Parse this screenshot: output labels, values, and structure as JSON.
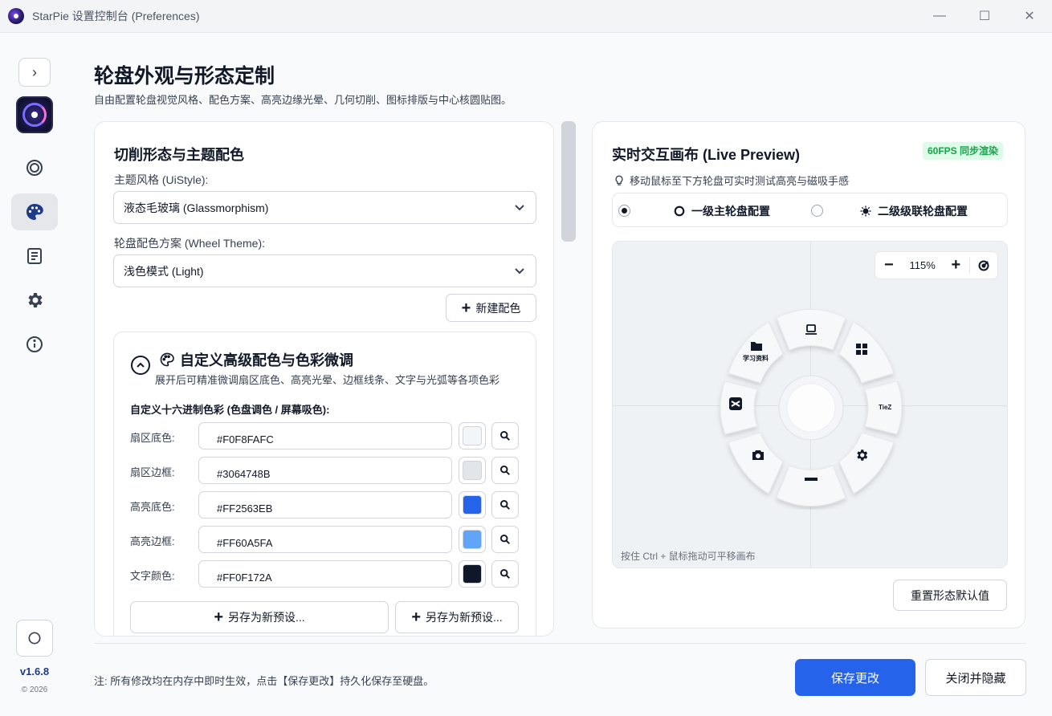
{
  "window": {
    "title": "StarPie 设置控制台 (Preferences)",
    "minimize_icon": "—",
    "maximize_icon": "☐",
    "close_icon": "✕"
  },
  "sidebar": {
    "toggle_glyph": "›",
    "version": "v1.6.8",
    "copyright": "© 2026",
    "items": [
      {
        "icon": "target-icon",
        "active": false
      },
      {
        "icon": "palette-icon",
        "active": true
      },
      {
        "icon": "document-icon",
        "active": false
      },
      {
        "icon": "gear-icon",
        "active": false
      },
      {
        "icon": "info-icon",
        "active": false
      }
    ]
  },
  "header": {
    "title": "轮盘外观与形态定制",
    "subtitle": "自由配置轮盘视觉风格、配色方案、高亮边缘光晕、几何切削、图标排版与中心核圆贴图。"
  },
  "left": {
    "section_title": "切削形态与主题配色",
    "style_label": "主题风格 (UiStyle):",
    "style_value": "液态毛玻璃 (Glassmorphism)",
    "theme_label": "轮盘配色方案 (Wheel Theme):",
    "theme_value": "浅色模式 (Light)",
    "new_theme_label": "新建配色",
    "advanced": {
      "title": "自定义高级配色与色彩微调",
      "desc": "展开后可精准微调扇区底色、高亮光晕、边框线条、文字与光弧等各项色彩",
      "hex_title": "自定义十六进制色彩 (色盘调色 / 屏幕吸色):",
      "colors": [
        {
          "label": "扇区底色:",
          "hex": "#F0F8FAFC",
          "swatch": "#f3f6f9"
        },
        {
          "label": "扇区边框:",
          "hex": "#3064748B",
          "swatch": "#e2e5ea"
        },
        {
          "label": "高亮底色:",
          "hex": "#FF2563EB",
          "swatch": "#2563eb"
        },
        {
          "label": "高亮边框:",
          "hex": "#FF60A5FA",
          "swatch": "#60a5fa"
        },
        {
          "label": "文字颜色:",
          "hex": "#FF0F172A",
          "swatch": "#0f172a"
        }
      ],
      "save_preset_1": "另存为新预设...",
      "save_preset_2": "另存为新预设..."
    }
  },
  "right": {
    "title": "实时交互画布 (Live Preview)",
    "fps_badge": "60FPS 同步渲染",
    "hint": "移动鼠标至下方轮盘可实时测试高亮与磁吸手感",
    "radio_primary": "一级主轮盘配置",
    "radio_secondary": "二级级联轮盘配置",
    "zoom": "115%",
    "canvas_hint": "按住 Ctrl + 鼠标拖动可平移画布",
    "wheel_labels": {
      "folder": "学习资料",
      "tiez": "TieZ"
    },
    "reset_label": "重置形态默认值"
  },
  "footer": {
    "note": "注: 所有修改均在内存中即时生效，点击【保存更改】持久化保存至硬盘。",
    "save_label": "保存更改",
    "close_label": "关闭并隐藏"
  },
  "colors": {
    "accent": "#2563eb",
    "badge_green": "#16a34a"
  }
}
